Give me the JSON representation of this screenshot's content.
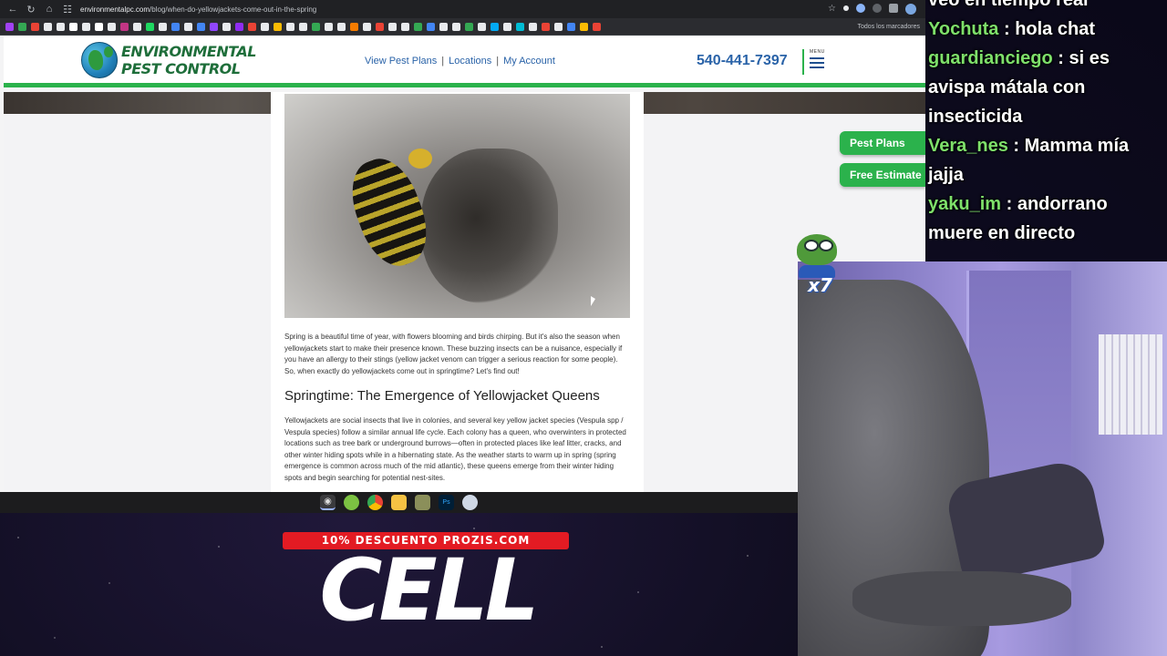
{
  "browser": {
    "url_domain": "environmentalpc.com",
    "url_path": "/blog/when-do-yellowjackets-come-out-in-the-spring",
    "bookmarks_all_label": "Todos los marcadores"
  },
  "site": {
    "logo_line1": "ENVIRONMENTAL",
    "logo_line2": "PEST CONTROL",
    "nav": [
      "View Pest Plans",
      "Locations",
      "My Account"
    ],
    "nav_separator": "|",
    "phone": "540-441-7397",
    "menu_label": "MENU",
    "side_buttons": {
      "plans": "Pest Plans",
      "estimate": "Free Estimate"
    }
  },
  "article": {
    "intro": "Spring is a beautiful time of year, with flowers blooming and birds chirping. But it's also the season when yellowjackets start to make their presence known. These buzzing insects can be a nuisance, especially if you have an allergy to their stings (yellow jacket venom can trigger a serious reaction for some people). So, when exactly do yellowjackets come out in springtime? Let's find out!",
    "heading": "Springtime: The Emergence of Yellowjacket Queens",
    "body": "Yellowjackets are social insects that live in colonies, and several key yellow jacket species (Vespula spp / Vespula species) follow a similar annual life cycle. Each colony has a queen, who overwinters in protected locations such as tree bark or underground burrows—often in protected places like leaf litter, cracks, and other winter hiding spots while in a hibernating state. As the weather starts to warm up in spring (spring emergence is common across much of the mid atlantic), these queens emerge from their winter hiding spots and begin searching for potential nest-sites."
  },
  "chat": [
    {
      "user": "",
      "message": "veo en tiempo real"
    },
    {
      "user": "Yochuta",
      "message": " : hola chat"
    },
    {
      "user": "guardianciego",
      "message": " : si es avispa mátala con insecticida"
    },
    {
      "user": "Vera_nes",
      "message": " : Mamma mía jajja"
    },
    {
      "user": "yaku_im",
      "message": " : andorrano muere en directo"
    }
  ],
  "emote": {
    "count": "x7"
  },
  "promo": {
    "banner": "10% DESCUENTO PROZIS.COM",
    "word": "CELL"
  },
  "colors": {
    "brand_green": "#2bb24c",
    "link_blue": "#2a63a8",
    "chat_username": "#7ee06a",
    "promo_red": "#e31b23"
  }
}
